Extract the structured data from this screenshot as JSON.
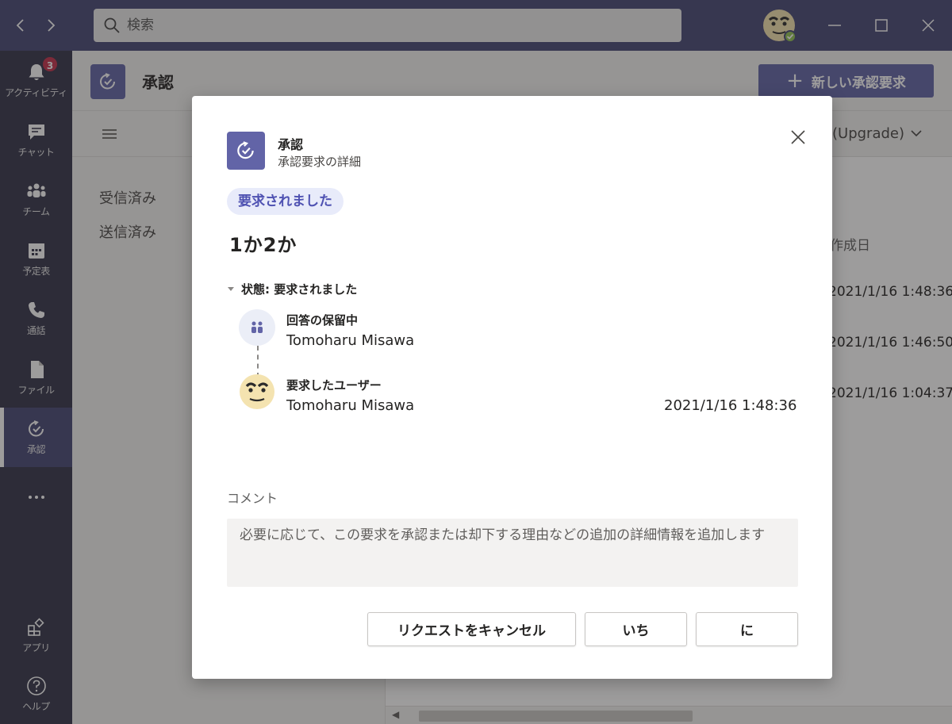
{
  "titlebar": {
    "search_placeholder": "検索",
    "back_icon": "chevron-left-icon",
    "forward_icon": "chevron-right-icon",
    "window_buttons": [
      "minimize",
      "maximize",
      "close"
    ]
  },
  "rail": {
    "items": [
      {
        "label": "アクティビティ",
        "icon": "bell-icon",
        "badge": "3"
      },
      {
        "label": "チャット",
        "icon": "chat-icon"
      },
      {
        "label": "チーム",
        "icon": "teams-icon"
      },
      {
        "label": "予定表",
        "icon": "calendar-icon"
      },
      {
        "label": "通話",
        "icon": "phone-icon"
      },
      {
        "label": "ファイル",
        "icon": "file-icon"
      },
      {
        "label": "承認",
        "icon": "approvals-icon",
        "active": true
      },
      {
        "label": "アプリ",
        "icon": "apps-icon"
      },
      {
        "label": "ヘルプ",
        "icon": "help-icon"
      }
    ]
  },
  "app": {
    "title": "承認",
    "new_request_label": "新しい承認要求",
    "upgrade_label": "(Upgrade)",
    "nav": [
      "受信済み",
      "送信済み"
    ],
    "col_header": "作成日",
    "dates": [
      "2021/1/16 1:48:36",
      "2021/1/16 1:46:50",
      "2021/1/16 1:04:37"
    ]
  },
  "dialog": {
    "app_name": "承認",
    "subtitle": "承認要求の詳細",
    "status_pill": "要求されました",
    "request_title": "1か2か",
    "status_line": "状態: 要求されました",
    "timeline": [
      {
        "heading": "回答の保留中",
        "name": "Tomoharu Misawa",
        "icon": "team-icon"
      },
      {
        "heading": "要求したユーザー",
        "name": "Tomoharu Misawa",
        "date": "2021/1/16 1:48:36",
        "icon": "avatar"
      }
    ],
    "comment_label": "コメント",
    "comment_placeholder": "必要に応じて、この要求を承認または却下する理由などの追加の詳細情報を追加します",
    "buttons": {
      "cancel": "リクエストをキャンセル",
      "option_one": "いち",
      "option_two": "に"
    }
  },
  "colors": {
    "brand": "#6264a7",
    "titlebar": "#464775",
    "rail": "#33344a",
    "badge": "#c4314b",
    "pill_bg": "#e8ebfa",
    "pill_text": "#4f52b2"
  }
}
